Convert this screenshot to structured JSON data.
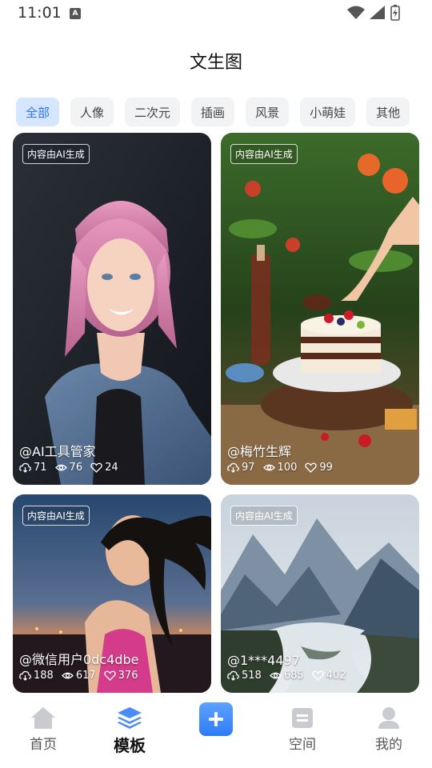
{
  "status_bar": {
    "time": "11:01",
    "a_badge": "A"
  },
  "page": {
    "title": "文生图"
  },
  "tabs": [
    {
      "label": "全部",
      "active": true
    },
    {
      "label": "人像"
    },
    {
      "label": "二次元"
    },
    {
      "label": "插画"
    },
    {
      "label": "风景"
    },
    {
      "label": "小萌娃"
    },
    {
      "label": "其他"
    }
  ],
  "cards": [
    {
      "badge": "内容由AI生成",
      "author": "@AI工具管家",
      "downloads": "71",
      "views": "76",
      "likes": "24"
    },
    {
      "badge": "内容由AI生成",
      "author": "@梅竹生辉",
      "downloads": "97",
      "views": "100",
      "likes": "99"
    },
    {
      "badge": "内容由AI生成",
      "author": "@微信用户0dc4dbe",
      "downloads": "188",
      "views": "617",
      "likes": "376"
    },
    {
      "badge": "内容由AI生成",
      "author": "@1***4497",
      "downloads": "518",
      "views": "685",
      "likes": "402"
    }
  ],
  "bottom_nav": {
    "home": "首页",
    "templates": "模板",
    "space": "空间",
    "mine": "我的"
  },
  "colors": {
    "accent": "#2a74ff",
    "active_tab_bg": "#d6e6ff"
  }
}
